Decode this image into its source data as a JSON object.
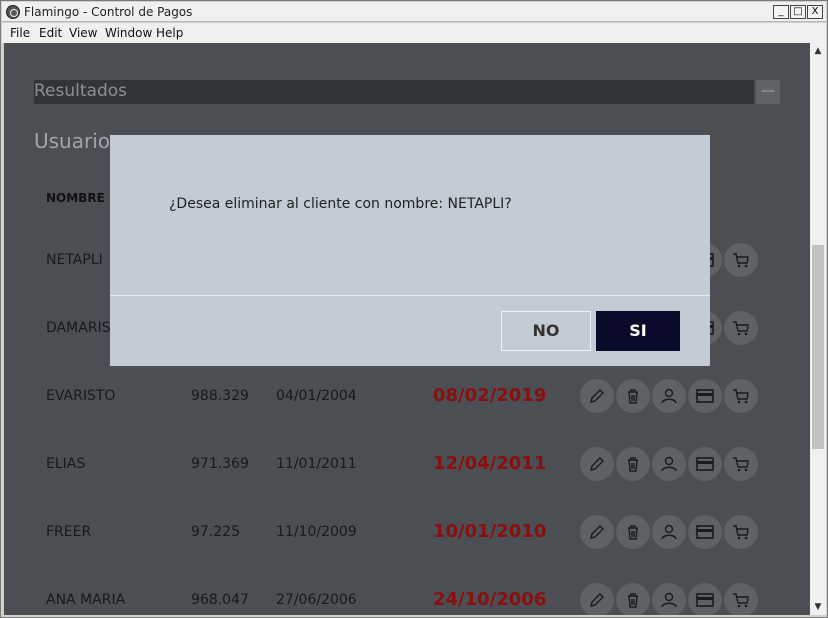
{
  "window": {
    "title": "Flamingo - Control de Pagos",
    "buttons": {
      "minimize": "_",
      "maximize": "□",
      "close": "X"
    }
  },
  "menu": [
    "File",
    "Edit",
    "View",
    "Window",
    "Help"
  ],
  "results": {
    "title": "Resultados",
    "collapse": "—"
  },
  "section": {
    "title": "Usuarios"
  },
  "table": {
    "header_name": "NOMBRE",
    "rows": [
      {
        "name": "NETAPLI",
        "number": "",
        "start": "",
        "due": ""
      },
      {
        "name": "DAMARIS",
        "number": "",
        "start": "",
        "due": ""
      },
      {
        "name": "EVARISTO",
        "number": "988.329",
        "start": "04/01/2004",
        "due": "08/02/2019"
      },
      {
        "name": "ELIAS",
        "number": "971.369",
        "start": "11/01/2011",
        "due": "12/04/2011"
      },
      {
        "name": "FREER",
        "number": "97.225",
        "start": "11/10/2009",
        "due": "10/01/2010"
      },
      {
        "name": "ANA MARIA",
        "number": "968.047",
        "start": "27/06/2006",
        "due": "24/10/2006"
      }
    ],
    "action_icons": [
      "pencil-icon",
      "trash-icon",
      "user-icon",
      "card-icon",
      "cart-icon"
    ]
  },
  "dialog": {
    "message": "¿Desea eliminar al cliente con nombre: NETAPLI?",
    "no_label": "NO",
    "yes_label": "SI"
  }
}
